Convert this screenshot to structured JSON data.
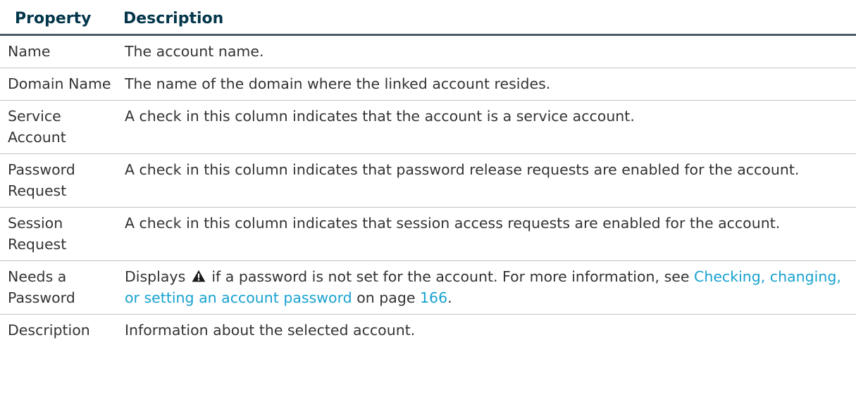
{
  "table": {
    "headers": {
      "property": "Property",
      "description": "Description"
    },
    "rows": [
      {
        "property": "Name",
        "description": "The account name."
      },
      {
        "property": "Domain Name",
        "description": "The name of the domain where the linked account resides."
      },
      {
        "property": "Service Account",
        "description": "A check in this column indicates that the account is a service account."
      },
      {
        "property": "Password Request",
        "description": "A check in this column indicates that password release requests are enabled for the account."
      },
      {
        "property": "Session Request",
        "description": "A check in this column indicates that session access requests are enabled for the account."
      },
      {
        "property": "Needs a Password",
        "description_parts": {
          "before_icon": "Displays",
          "icon": "warning-triangle-icon",
          "after_icon": "if a password is not set for the account. For more information, see",
          "link_text": "Checking, changing, or setting an account password",
          "mid_text": "on page",
          "page_link": "166",
          "end": "."
        }
      },
      {
        "property": "Description",
        "description": "Information about the selected account."
      }
    ]
  },
  "colors": {
    "header_text": "#02364a",
    "body_text": "#333333",
    "link": "#17a2cf",
    "header_rule": "#4a5a64",
    "row_rule": "#bcc3c8"
  }
}
